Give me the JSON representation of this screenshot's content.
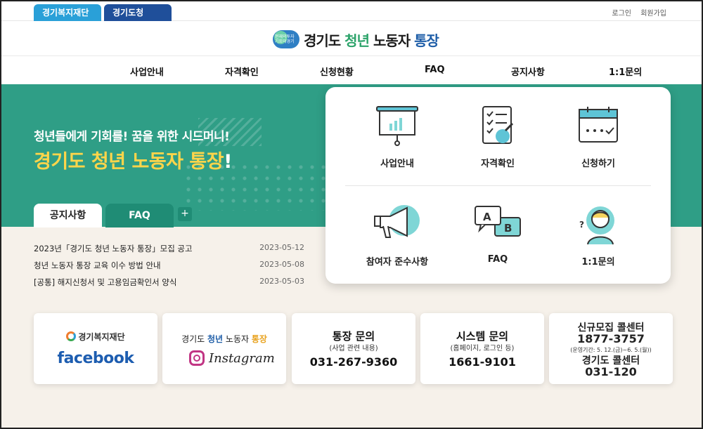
{
  "top_tabs": [
    "경기복지재단",
    "경기도청"
  ],
  "top_links": [
    "로그인",
    "회원가입"
  ],
  "logo": {
    "badge_text": "현재의투자 기회의경기",
    "part1": "경기도 ",
    "part2": "청년",
    "part3": " 노동자 ",
    "part4": "통장"
  },
  "nav": [
    "사업안내",
    "자격확인",
    "신청현황",
    "FAQ",
    "공지사항",
    "1:1문의"
  ],
  "hero": {
    "subtitle": "청년들에게 기회를! 꿈을 위한 시드머니!",
    "title": "경기도 청년 노동자 통장",
    "title_ex": "!"
  },
  "board": {
    "tabs": [
      "공지사항",
      "FAQ"
    ],
    "plus": "+",
    "items": [
      {
        "title": "2023년「경기도 청년 노동자 통장」모집 공고",
        "date": "2023-05-12"
      },
      {
        "title": "청년 노동자 통장 교육 이수 방법 안내",
        "date": "2023-05-08"
      },
      {
        "title": "[공통] 해지신청서 및 고용임금확인서 양식",
        "date": "2023-05-03"
      }
    ]
  },
  "quick_menu": [
    {
      "label": "사업안내",
      "icon": "presentation-board-icon"
    },
    {
      "label": "자격확인",
      "icon": "checklist-icon"
    },
    {
      "label": "신청하기",
      "icon": "calendar-check-icon"
    },
    {
      "label": "참여자 준수사항",
      "icon": "megaphone-icon"
    },
    {
      "label": "FAQ",
      "icon": "ab-speech-bubbles-icon"
    },
    {
      "label": "1:1문의",
      "icon": "support-agent-icon"
    }
  ],
  "cards": {
    "facebook": {
      "org": "경기복지재단",
      "word": "facebook"
    },
    "instagram": {
      "pre": "경기도 ",
      "mid": "청년",
      "post": " 노동자 ",
      "end": "통장",
      "word": "Instagram"
    },
    "bank": {
      "title": "통장 문의",
      "sub": "(사업 관련 내용)",
      "number": "031-267-9360"
    },
    "system": {
      "title": "시스템 문의",
      "sub": "(홈페이지, 로그인 등)",
      "number": "1661-9101"
    },
    "call": {
      "l1": "신규모집 콜센터",
      "l2": "1877-3757",
      "l3": "(운영기간: 5. 12.(금)~6. 5.(월))",
      "l4": "경기도 콜센터",
      "l5": "031-120"
    }
  }
}
